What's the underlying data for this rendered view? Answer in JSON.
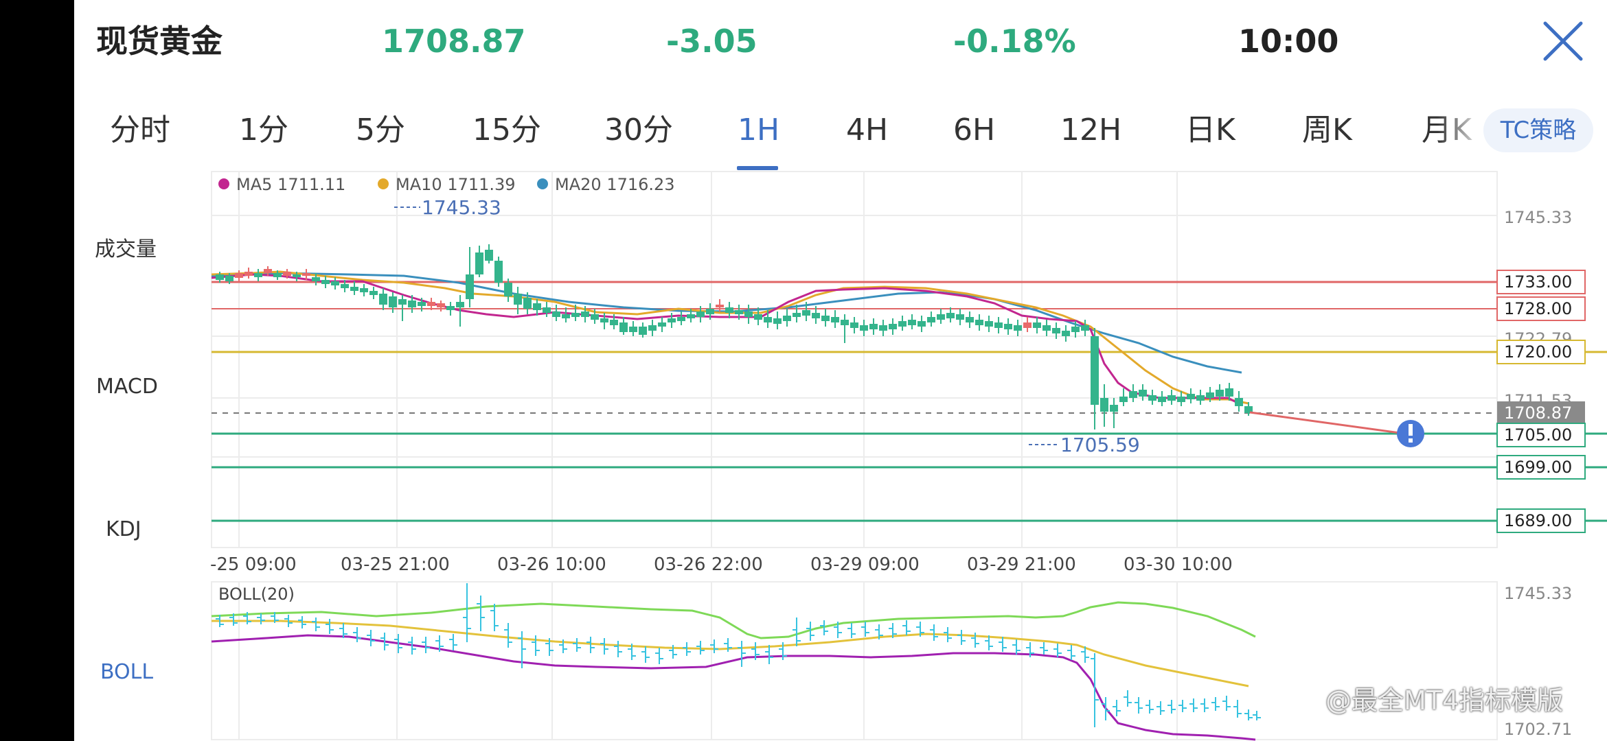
{
  "header": {
    "symbol": "现货黄金",
    "price": "1708.87",
    "change": "-3.05",
    "change_pct": "-0.18%",
    "time": "10:00",
    "up_color": "#2eaa7e",
    "close_icon": "close-icon"
  },
  "tabs": [
    {
      "label": "分时",
      "active": false
    },
    {
      "label": "1分",
      "active": false
    },
    {
      "label": "5分",
      "active": false
    },
    {
      "label": "15分",
      "active": false
    },
    {
      "label": "30分",
      "active": false
    },
    {
      "label": "1H",
      "active": true
    },
    {
      "label": "4H",
      "active": false
    },
    {
      "label": "6H",
      "active": false
    },
    {
      "label": "12H",
      "active": false
    },
    {
      "label": "日K",
      "active": false
    },
    {
      "label": "周K",
      "active": false
    },
    {
      "label": "月K",
      "active": false
    }
  ],
  "strategy_button": "TC策略",
  "side_labels": {
    "volume": "成交量",
    "macd": "MACD",
    "kdj": "KDJ",
    "boll": "BOLL"
  },
  "main_chart": {
    "legend": [
      {
        "name": "MA5",
        "value": "1711.11",
        "color": "#c2268f"
      },
      {
        "name": "MA10",
        "value": "1711.39",
        "color": "#e3a92b"
      },
      {
        "name": "MA20",
        "value": "1716.23",
        "color": "#3a8fbd"
      }
    ],
    "price_axis_labels": [
      "1745.33",
      "1722.79",
      "1711.53"
    ],
    "max_marker": "1745.33",
    "min_marker": "1705.59",
    "current_price": "1708.87",
    "x_labels": [
      "-25 09:00",
      "03-25 21:00",
      "03-26 10:00",
      "03-26 22:00",
      "03-29 09:00",
      "03-29 21:00",
      "03-30 10:00"
    ],
    "horizontal_levels": [
      {
        "label": "1733.00",
        "color": "#e06666"
      },
      {
        "label": "1728.00",
        "color": "#e06666"
      },
      {
        "label": "1720.00",
        "color": "#d6b830"
      },
      {
        "label": "1705.00",
        "color": "#2eaa7e"
      },
      {
        "label": "1699.00",
        "color": "#2eaa7e"
      },
      {
        "label": "1689.00",
        "color": "#2eaa7e"
      }
    ],
    "alert_icon": "exclamation-icon",
    "up_candle_color": "#e86a6a",
    "down_candle_color": "#34b48c"
  },
  "boll_chart": {
    "title": "BOLL(20)",
    "axis_labels": [
      "1745.33",
      "1702.71"
    ]
  },
  "watermark": "@最全MT4指标模版"
}
